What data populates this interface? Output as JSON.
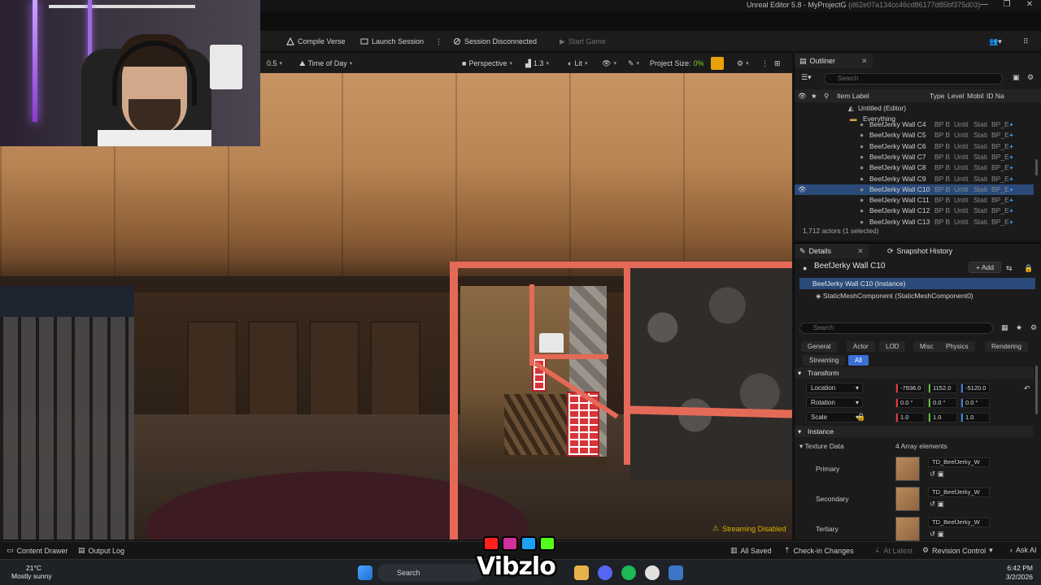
{
  "window": {
    "title": "Unreal Editor 5.8 - MyProjectG",
    "hash": "(d62e07a134cc46cd86177d85bf375d03)",
    "controls": [
      "—",
      "❐",
      "✕"
    ]
  },
  "toolbar": {
    "compile": "Compile Verse",
    "launch": "Launch Session",
    "session": "Session Disconnected",
    "start": "Start Game"
  },
  "viewport_toolbar": {
    "speed": "0.5",
    "time_of_day": "Time of Day",
    "perspective": "Perspective",
    "fov": "1.3",
    "lit": "Lit",
    "project_size_label": "Project Size:",
    "project_size_value": "0%"
  },
  "viewport": {
    "streaming": "Streaming Disabled"
  },
  "outliner": {
    "tab": "Outliner",
    "search_placeholder": "Search",
    "col_label": "Item Label",
    "col_type": "Type",
    "col_level": "Level",
    "col_mobil": "Mobil",
    "col_id": "ID Na",
    "root": "Untitled (Editor)",
    "folder": "Everything",
    "rows": [
      {
        "label": "BeefJerky Wall C4",
        "type": "BP B",
        "level": "Untit",
        "mob": "Stati",
        "id": "BP_E"
      },
      {
        "label": "BeefJerky Wall C5",
        "type": "BP B",
        "level": "Untit",
        "mob": "Stati",
        "id": "BP_E"
      },
      {
        "label": "BeefJerky Wall C6",
        "type": "BP B",
        "level": "Untit",
        "mob": "Stati",
        "id": "BP_E"
      },
      {
        "label": "BeefJerky Wall C7",
        "type": "BP B",
        "level": "Untit",
        "mob": "Stati",
        "id": "BP_E"
      },
      {
        "label": "BeefJerky Wall C8",
        "type": "BP B",
        "level": "Untit",
        "mob": "Stati",
        "id": "BP_E"
      },
      {
        "label": "BeefJerky Wall C9",
        "type": "BP B",
        "level": "Untit",
        "mob": "Stati",
        "id": "BP_E"
      },
      {
        "label": "BeefJerky Wall C10",
        "type": "BP B",
        "level": "Untit",
        "mob": "Stati",
        "id": "BP_E"
      },
      {
        "label": "BeefJerky Wall C11",
        "type": "BP B",
        "level": "Untit",
        "mob": "Stati",
        "id": "BP_E"
      },
      {
        "label": "BeefJerky Wall C12",
        "type": "BP B",
        "level": "Untit",
        "mob": "Stati",
        "id": "BP_E"
      },
      {
        "label": "BeefJerky Wall C13",
        "type": "BP B",
        "level": "Untit",
        "mob": "Stati",
        "id": "BP_E"
      }
    ],
    "footer": "1,712 actors (1 selected)"
  },
  "details": {
    "tab": "Details",
    "tab2": "Snapshot History",
    "title": "BeefJerky Wall C10",
    "add": "Add",
    "instance": "BeefJerky Wall C10 (Instance)",
    "component": "StaticMeshComponent (StaticMeshComponent0)",
    "search_placeholder": "Search",
    "filters": [
      "General",
      "Actor",
      "LOD",
      "Misc",
      "Physics",
      "Rendering",
      "Streaming",
      "All"
    ],
    "transform": "Transform",
    "location": {
      "label": "Location",
      "x": "-7936.0",
      "y": "1152.0",
      "z": "-5120.0"
    },
    "rotation": {
      "label": "Rotation",
      "x": "0.0 °",
      "y": "0.0 °",
      "z": "0.0 °"
    },
    "scale": {
      "label": "Scale",
      "x": "1.0",
      "y": "1.0",
      "z": "1.0"
    },
    "instance_section": "Instance",
    "texture_data": "Texture Data",
    "array_count": "4 Array elements",
    "textures": [
      {
        "slot": "Primary",
        "name": "TD_BeefJerky_W"
      },
      {
        "slot": "Secondary",
        "name": "TD_BeefJerky_W"
      },
      {
        "slot": "Tertiary",
        "name": "TD_BeefJerky_W"
      }
    ]
  },
  "statusbar": {
    "content_drawer": "Content Drawer",
    "output_log": "Output Log",
    "all_saved": "All Saved",
    "check_in": "Check-in Changes",
    "at_latest": "At Latest",
    "revision": "Revision Control",
    "ask_ai": "Ask AI"
  },
  "taskbar": {
    "temp": "21°C",
    "weather": "Mostly sunny",
    "search": "Search",
    "time": "6:42 PM",
    "date": "3/2/2026"
  },
  "overlay": {
    "brand": "Vibzlo"
  },
  "colors": {
    "selection": "#e46a57",
    "accent": "#3a6fd4",
    "snap": "#e8a10a"
  }
}
